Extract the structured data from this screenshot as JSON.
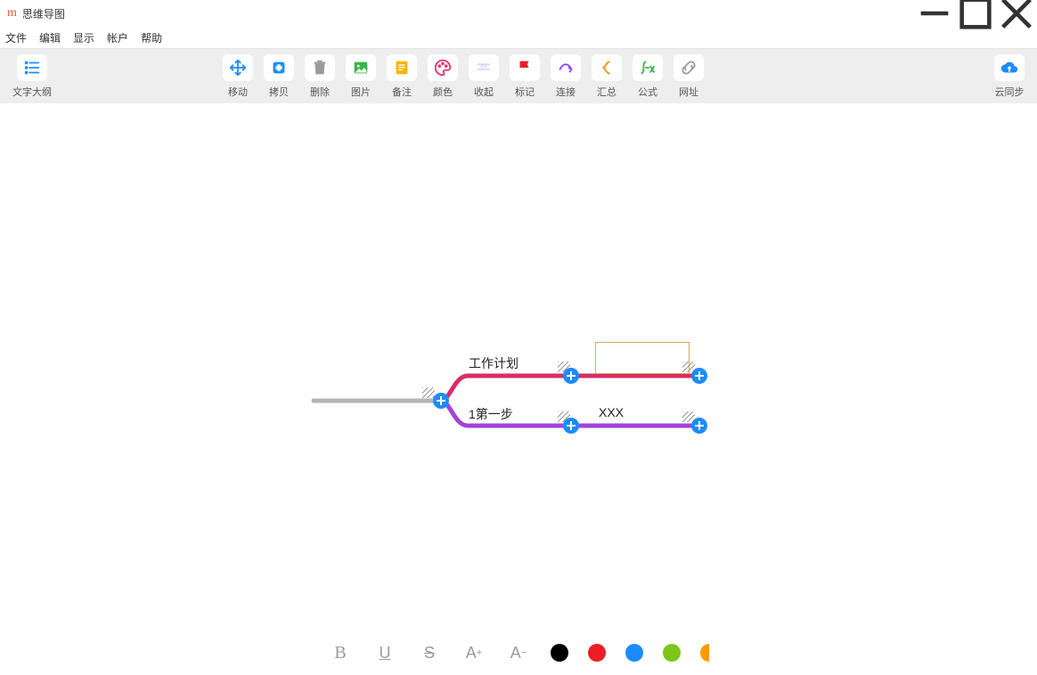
{
  "window": {
    "title": "思维导图"
  },
  "menu": {
    "file": "文件",
    "edit": "编辑",
    "view": "显示",
    "account": "帐户",
    "help": "帮助"
  },
  "toolbar": {
    "outline": "文字大纲",
    "move": "移动",
    "copy": "拷贝",
    "delete": "删除",
    "image": "图片",
    "note": "备注",
    "color": "颜色",
    "collapse": "收起",
    "mark": "标记",
    "connect": "连接",
    "summary": "汇总",
    "formula": "公式",
    "url": "网址",
    "cloudsync": "云同步"
  },
  "mindmap": {
    "nodes": {
      "work_plan": "工作计划",
      "step1": "1第一步",
      "xxx": "XXX"
    },
    "colors": {
      "branch1": "#d62e64",
      "branch2": "#a342d8",
      "stem": "#b5b5b5"
    }
  },
  "bottombar": {
    "bold": "B",
    "underline": "U",
    "strike": "S",
    "inc": "A+",
    "dec": "A-",
    "colors": [
      "#000000",
      "#ee1c25",
      "#1a8cff",
      "#7cc61a",
      "#ff9a00"
    ]
  }
}
